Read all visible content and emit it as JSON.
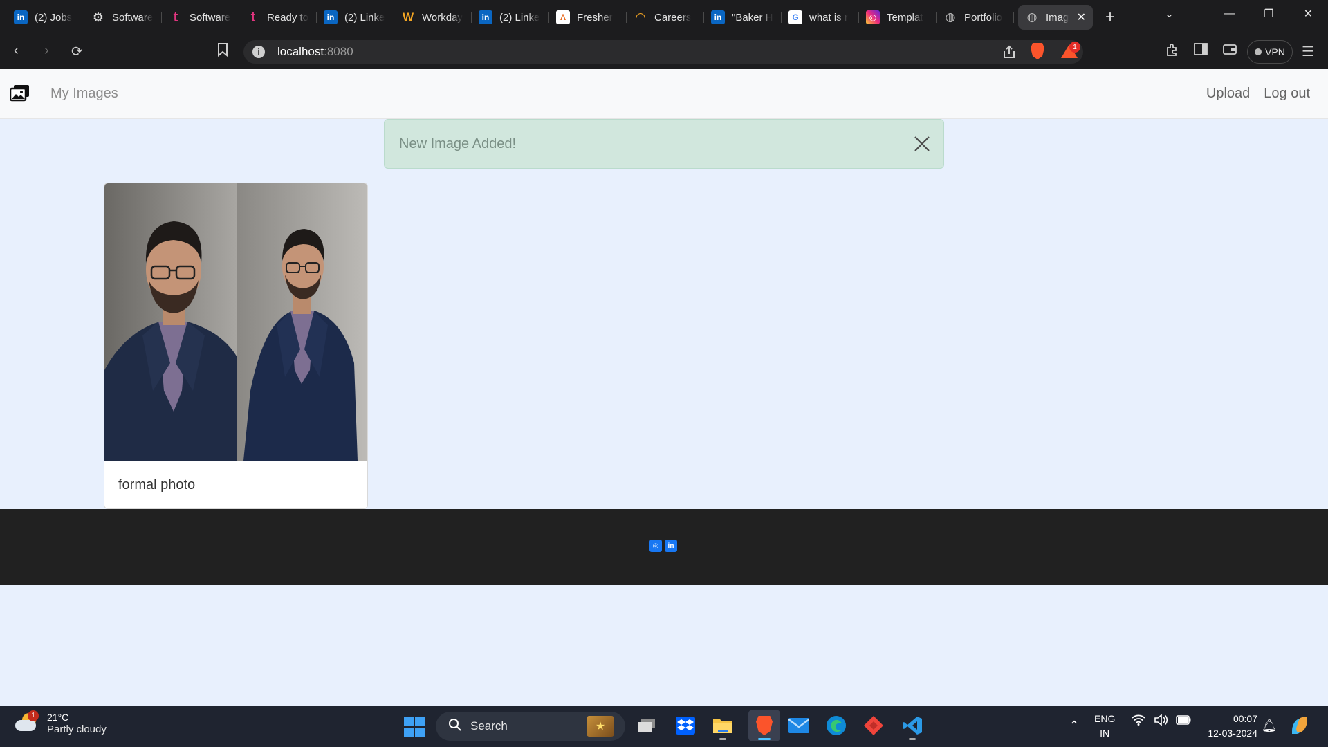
{
  "browser": {
    "tabs": [
      {
        "title": "(2) Jobs",
        "icon": "linkedin-icon"
      },
      {
        "title": "Software",
        "icon": "gear-icon"
      },
      {
        "title": "Software",
        "icon": "tech-t-icon"
      },
      {
        "title": "Ready to",
        "icon": "tech-t-icon"
      },
      {
        "title": "(2) Linke",
        "icon": "linkedin-icon"
      },
      {
        "title": "Workday",
        "icon": "workday-icon"
      },
      {
        "title": "(2) Linke",
        "icon": "linkedin-icon"
      },
      {
        "title": "Fresher",
        "icon": "fresher-icon"
      },
      {
        "title": "Careers",
        "icon": "careers-icon"
      },
      {
        "title": "\"Baker H",
        "icon": "linkedin-icon"
      },
      {
        "title": "what is r",
        "icon": "google-icon"
      },
      {
        "title": "Templat",
        "icon": "instagram-icon"
      },
      {
        "title": "Portfolio",
        "icon": "globe-icon"
      }
    ],
    "active_tab": {
      "title": "Imag",
      "icon": "globe-icon"
    },
    "url_host": "localhost",
    "url_port": ":8080",
    "rewards_badge": "1",
    "vpn_label": "VPN"
  },
  "app": {
    "brand": "My Images",
    "nav": {
      "upload": "Upload",
      "logout": "Log out"
    },
    "alert": {
      "message": "New Image Added!"
    },
    "cards": [
      {
        "caption": "formal photo"
      }
    ]
  },
  "taskbar": {
    "weather": {
      "temp": "21°C",
      "condition": "Partly cloudy",
      "badge": "1"
    },
    "search_placeholder": "Search",
    "language": {
      "line1": "ENG",
      "line2": "IN"
    },
    "time": "00:07",
    "date": "12-03-2024"
  },
  "colors": {
    "page_bg": "#e8f0fd",
    "alert_bg": "#d1e7dd",
    "footer_bg": "#212121",
    "brave_accent": "#fb542b"
  }
}
